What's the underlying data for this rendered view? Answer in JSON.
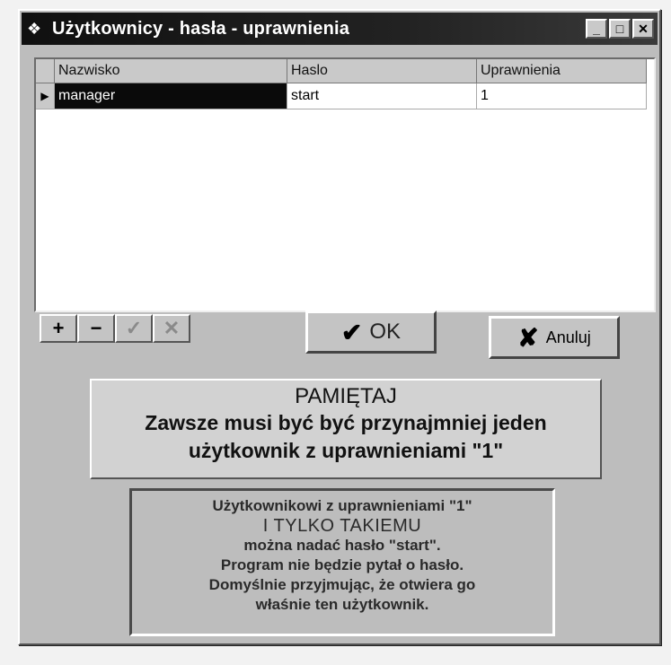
{
  "window": {
    "title": "Użytkownicy - hasła - uprawnienia",
    "app_icon": "app-icon",
    "buttons": [
      "minimize",
      "maximize",
      "close"
    ]
  },
  "grid": {
    "columns": [
      "Nazwisko",
      "Haslo",
      "Uprawnienia"
    ],
    "rows": [
      {
        "indicator": "▶",
        "nazwisko": "manager",
        "haslo": "start",
        "uprawnienia": "1"
      }
    ]
  },
  "toolbar": {
    "add": "+",
    "delete": "−",
    "post": "✓",
    "cancel": "✕"
  },
  "actions": {
    "ok_label": "OK",
    "cancel_label": "Anuluj"
  },
  "notice": {
    "heading": "PAMIĘTAJ",
    "line2": "Zawsze musi być być przynajmniej jeden",
    "line3": "użytkownik z uprawnieniami \"1\""
  },
  "info": {
    "l1": "Użytkownikowi z uprawnieniami \"1\"",
    "l2": "I TYLKO TAKIEMU",
    "l3": "można nadać hasło \"start\".",
    "l4": "Program nie będzie pytał o hasło.",
    "l5": "Domyślnie przyjmując, że otwiera go",
    "l6": "właśnie ten użytkownik."
  }
}
